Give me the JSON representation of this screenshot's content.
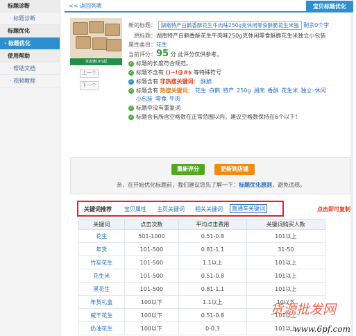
{
  "sidebar": {
    "items": [
      {
        "label": "标题诊断",
        "type": "group"
      },
      {
        "label": "· 标题诊断",
        "type": "item"
      },
      {
        "label": "标题优化",
        "type": "group"
      },
      {
        "label": "· 标题优化",
        "type": "active"
      },
      {
        "label": "使用帮助",
        "type": "group"
      },
      {
        "label": "· 帮助文档",
        "type": "item"
      },
      {
        "label": "· 视频教程",
        "type": "item"
      }
    ]
  },
  "header": {
    "back_label": "<< 返回列表",
    "tab_label": "宝贝标题优化"
  },
  "product": {
    "badge": "全店满19元起",
    "prev_label": "上一个",
    "next_label": "下一个"
  },
  "info": {
    "new_title_label": "新的标题：",
    "new_title_value": "湖南特产白鹤香酥花生牛肉味250g克休闲零食酥脆花生米独",
    "remaining": "剩余0个字",
    "orig_title_label": "原标题：",
    "orig_title_value": "湖南特产白鹤香酥花生牛肉味250g克休闲零食酥脆花生米独立小包装",
    "category_label": "属性类目：",
    "category_value": "花生",
    "score_label": "当前评分：",
    "score_value": "95",
    "score_unit": "分",
    "score_note": "此评分仅供参考。",
    "checks": [
      {
        "text": "标题的长度符合规范。"
      },
      {
        "text_a": "标题不含有",
        "text_b": "()~!@#$",
        "text_c": "等特殊符号"
      },
      {
        "text_a": "标题含有",
        "text_b": "非热搜关键词：",
        "text_c": "酥脆"
      },
      {
        "text_a": "标题含有",
        "text_b": "热搜关键词："
      },
      {
        "text": "标题中没有重复词"
      },
      {
        "text": "标题含有所含空格数在正常范围以内，建议空格数保持在6个以下！"
      }
    ],
    "hot_keywords": [
      "花生",
      "白鹤",
      "特产",
      "250g",
      "湖南",
      "香酥",
      "花生米",
      "独立",
      "休闲",
      "小包装",
      "零食",
      "牛肉"
    ]
  },
  "panel": {
    "rescore_label": "重新评分",
    "update_label": "更新到店铺",
    "text_a": "亲，在开始优化标题前，我们建议您先了解一下：",
    "text_link": "标题优化原则",
    "text_b": "，避免违规。"
  },
  "tabs": {
    "items": [
      "关键词推荐",
      "宝贝属性",
      "主页关键词",
      "相关关键词",
      "直通车关键词"
    ],
    "copy_hint": "点击即可复制"
  },
  "table": {
    "headers": [
      "关键词",
      "点击次数",
      "平均点击费用",
      "关键词购买人数"
    ],
    "rows": [
      [
        "花生",
        "501-1000",
        "0.51-0.8",
        "101以上"
      ],
      [
        "年货",
        "101-500",
        "0.81-1.1",
        "31-50"
      ],
      [
        "竹炭花生",
        "101-500",
        "1.1以上",
        "101以上"
      ],
      [
        "花生米",
        "101-500",
        "0.51-0.8",
        "101以上"
      ],
      [
        "黑花生",
        "101-500",
        "0.81-1.1",
        "101以上"
      ],
      [
        "年货礼盒",
        "100以下",
        "1.1以上",
        "10以下"
      ],
      [
        "威干花生",
        "100以下",
        "0.51-0.8",
        "101以上"
      ],
      [
        "奶油花生",
        "100以下",
        "0-0.3",
        "101以上"
      ]
    ]
  },
  "watermark": {
    "line1": "货源批发网",
    "line2": "www.6pf.com"
  }
}
